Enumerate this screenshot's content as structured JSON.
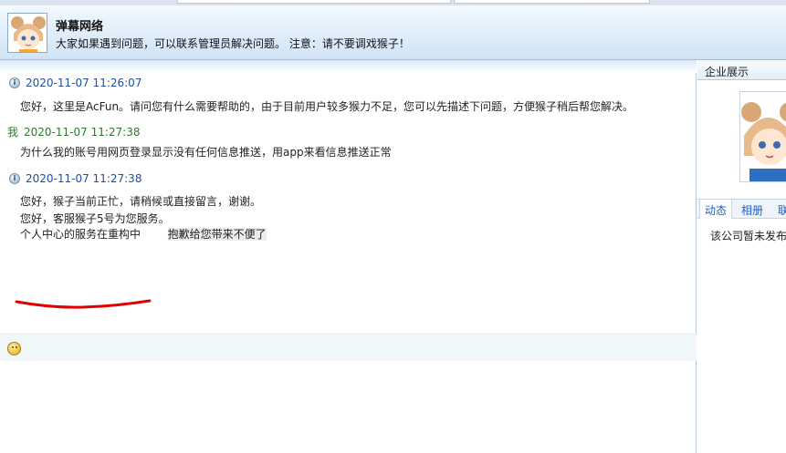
{
  "header": {
    "title": "弹幕网络",
    "subtitle": "大家如果遇到问题，可以联系管理员解决问题。 注意：请不要调戏猴子！"
  },
  "messages": [
    {
      "time": "2020-11-07 11:26:07",
      "sender": "",
      "lines": [
        "您好，这里是AcFun。请问您有什么需要帮助的，由于目前用户较多猴力不足，您可以先描述下问题，方便猴子稍后帮您解决。"
      ]
    },
    {
      "time": "2020-11-07 11:27:38",
      "sender": "我",
      "lines": [
        "为什么我的账号用网页登录显示没有任何信息推送，用app来看信息推送正常"
      ]
    },
    {
      "time": "2020-11-07 11:27:38",
      "sender": "",
      "lines": [
        "您好，猴子当前正忙，请稍候或直接留言，谢谢。",
        "您好，客服猴子5号为您服务。"
      ],
      "last_line_part1": "个人中心的服务在重构中",
      "last_line_part2": "抱歉给您带来不便了"
    }
  ],
  "sidebar": {
    "title": "企业展示",
    "tabs": [
      "动态",
      "相册",
      "联"
    ],
    "empty_text": "该公司暂未发布"
  },
  "colors": {
    "accent_blue": "#1f4fa0",
    "me_green": "#2c7a2c",
    "annotation_red": "#e00000"
  }
}
